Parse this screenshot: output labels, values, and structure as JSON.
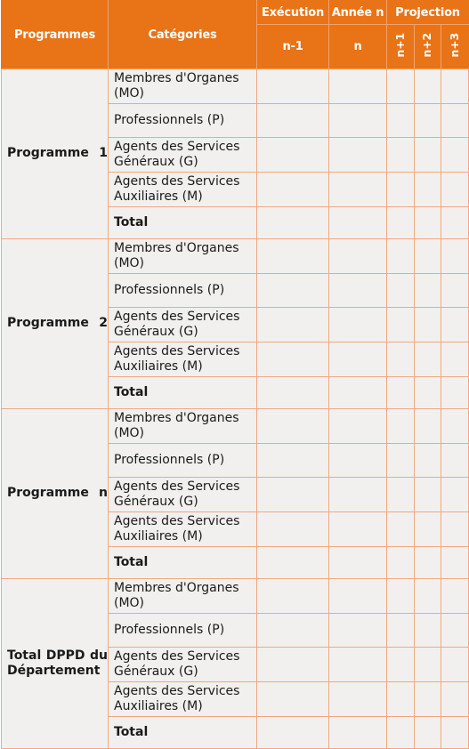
{
  "table": {
    "header": {
      "programmes": "Programmes",
      "categories": "Catégories",
      "groups": [
        {
          "label": "Exécution",
          "sub": "n-1",
          "orientation": "horizontal"
        },
        {
          "label": "Année n",
          "sub": "n",
          "orientation": "horizontal"
        },
        {
          "label": "Projection",
          "subs": [
            "n+1",
            "n+2",
            "n+3"
          ],
          "orientation": "vertical"
        }
      ],
      "projection_label": "Projection",
      "execution_label": "Exécution",
      "annee_label": "Année n",
      "exec_sub": "n-1",
      "annee_sub": "n",
      "proj_sub_1": "n+1",
      "proj_sub_2": "n+2",
      "proj_sub_3": "n+3"
    },
    "categories": {
      "membres": "Membres d'Organes (MO)",
      "professionnels": "Professionnels (P)",
      "generaux": "Agents des Services Généraux (G)",
      "auxiliaires": "Agents des Services Auxiliaires (M)",
      "total": "Total"
    },
    "blocks": [
      {
        "label": "Programme 1",
        "highlight": false,
        "rows": [
          {
            "category": "Membres d'Organes (MO)",
            "exec_n_1": "",
            "annee_n": "",
            "n_plus_1": "",
            "n_plus_2": "",
            "n_plus_3": ""
          },
          {
            "category": "Professionnels (P)",
            "exec_n_1": "",
            "annee_n": "",
            "n_plus_1": "",
            "n_plus_2": "",
            "n_plus_3": ""
          },
          {
            "category": "Agents des Services Généraux (G)",
            "exec_n_1": "",
            "annee_n": "",
            "n_plus_1": "",
            "n_plus_2": "",
            "n_plus_3": ""
          },
          {
            "category": "Agents des Services Auxiliaires (M)",
            "exec_n_1": "",
            "annee_n": "",
            "n_plus_1": "",
            "n_plus_2": "",
            "n_plus_3": ""
          },
          {
            "category": "Total",
            "exec_n_1": "",
            "annee_n": "",
            "n_plus_1": "",
            "n_plus_2": "",
            "n_plus_3": ""
          }
        ]
      },
      {
        "label": "Programme 2",
        "highlight": false,
        "rows": [
          {
            "category": "Membres d'Organes (MO)",
            "exec_n_1": "",
            "annee_n": "",
            "n_plus_1": "",
            "n_plus_2": "",
            "n_plus_3": ""
          },
          {
            "category": "Professionnels (P)",
            "exec_n_1": "",
            "annee_n": "",
            "n_plus_1": "",
            "n_plus_2": "",
            "n_plus_3": ""
          },
          {
            "category": "Agents des Services Généraux (G)",
            "exec_n_1": "",
            "annee_n": "",
            "n_plus_1": "",
            "n_plus_2": "",
            "n_plus_3": ""
          },
          {
            "category": "Agents des Services Auxiliaires (M)",
            "exec_n_1": "",
            "annee_n": "",
            "n_plus_1": "",
            "n_plus_2": "",
            "n_plus_3": ""
          },
          {
            "category": "Total",
            "exec_n_1": "",
            "annee_n": "",
            "n_plus_1": "",
            "n_plus_2": "",
            "n_plus_3": ""
          }
        ]
      },
      {
        "label": "Programme n",
        "highlight": false,
        "rows": [
          {
            "category": "Membres d'Organes (MO)",
            "exec_n_1": "",
            "annee_n": "",
            "n_plus_1": "",
            "n_plus_2": "",
            "n_plus_3": ""
          },
          {
            "category": "Professionnels (P)",
            "exec_n_1": "",
            "annee_n": "",
            "n_plus_1": "",
            "n_plus_2": "",
            "n_plus_3": ""
          },
          {
            "category": "Agents des Services Généraux (G)",
            "exec_n_1": "",
            "annee_n": "",
            "n_plus_1": "",
            "n_plus_2": "",
            "n_plus_3": ""
          },
          {
            "category": "Agents des Services Auxiliaires (M)",
            "exec_n_1": "",
            "annee_n": "",
            "n_plus_1": "",
            "n_plus_2": "",
            "n_plus_3": ""
          },
          {
            "category": "Total",
            "exec_n_1": "",
            "annee_n": "",
            "n_plus_1": "",
            "n_plus_2": "",
            "n_plus_3": ""
          }
        ]
      },
      {
        "label": "Total DPPD du Département",
        "highlight": true,
        "rows": [
          {
            "category": "Membres d'Organes (MO)",
            "exec_n_1": "",
            "annee_n": "",
            "n_plus_1": "",
            "n_plus_2": "",
            "n_plus_3": ""
          },
          {
            "category": "Professionnels (P)",
            "exec_n_1": "",
            "annee_n": "",
            "n_plus_1": "",
            "n_plus_2": "",
            "n_plus_3": ""
          },
          {
            "category": "Agents des Services Généraux (G)",
            "exec_n_1": "",
            "annee_n": "",
            "n_plus_1": "",
            "n_plus_2": "",
            "n_plus_3": ""
          },
          {
            "category": "Agents des Services Auxiliaires (M)",
            "exec_n_1": "",
            "annee_n": "",
            "n_plus_1": "",
            "n_plus_2": "",
            "n_plus_3": ""
          },
          {
            "category": "Total",
            "exec_n_1": "",
            "annee_n": "",
            "n_plus_1": "",
            "n_plus_2": "",
            "n_plus_3": ""
          }
        ]
      }
    ]
  },
  "colors": {
    "header_orange": "#E97317",
    "grid_line": "#F0A882",
    "body_background": "#F1F0EF",
    "highlight_background": "#FBE1CE",
    "header_text": "#FFFFFF",
    "body_text": "#1A1A1A"
  }
}
